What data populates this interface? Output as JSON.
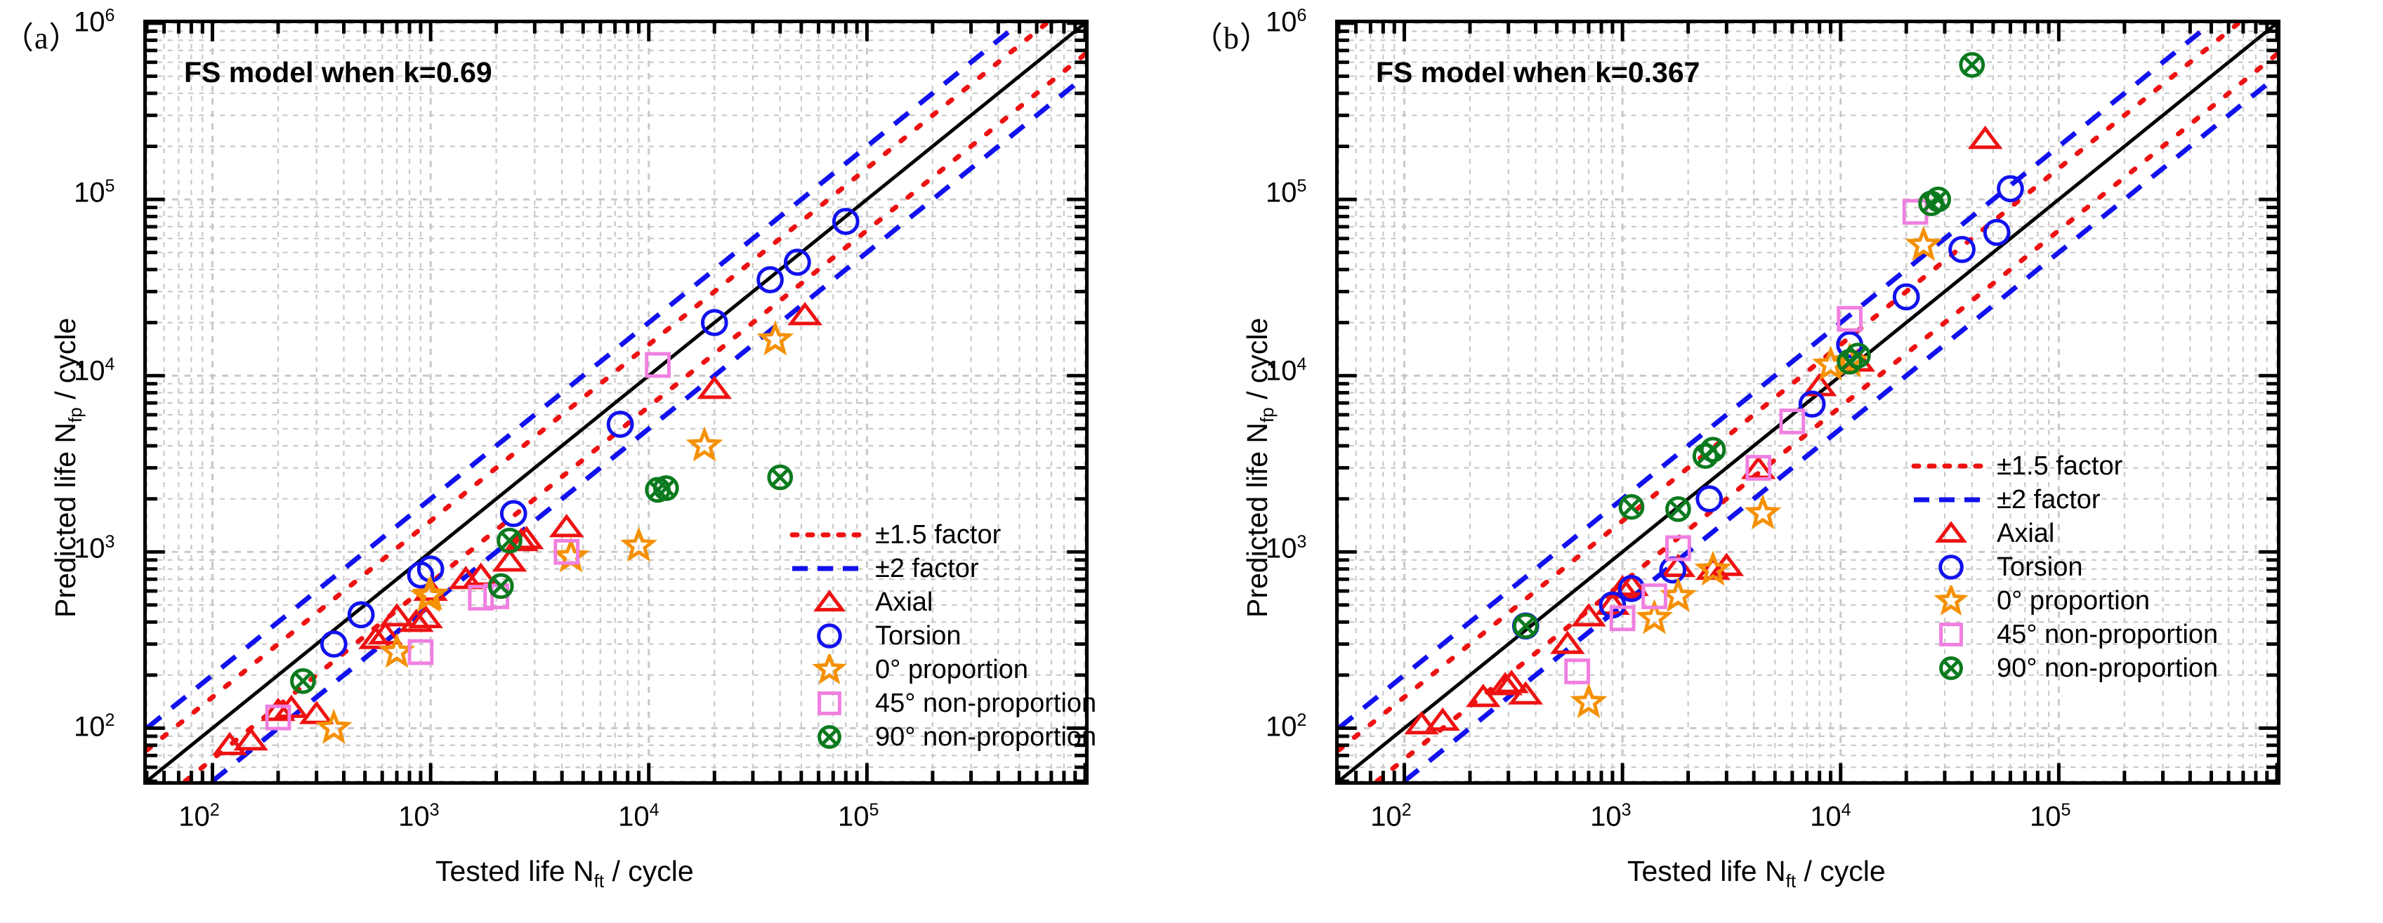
{
  "figure": {
    "panels": [
      {
        "tag": "（a）",
        "title": "FS model when k=0.69",
        "corner_label": "10",
        "corner_exp": "6"
      },
      {
        "tag": "（b）",
        "title": "FS model when k=0.367",
        "corner_label": "10",
        "corner_exp": "6"
      }
    ],
    "axis": {
      "xlabel_pre": "Tested life N",
      "xlabel_sub": "ft",
      "xlabel_post": " / cycle",
      "ylabel_pre": "Predicted life N",
      "ylabel_sub": "fp",
      "ylabel_post": " / cycle",
      "xticks": [
        "10",
        "10",
        "10",
        "10"
      ],
      "xtick_exps": [
        "2",
        "3",
        "4",
        "5"
      ],
      "yticks": [
        "10",
        "10",
        "10",
        "10"
      ],
      "ytick_exps": [
        "2",
        "3",
        "4",
        "5"
      ]
    },
    "legend": {
      "items": [
        {
          "label": "±1.5 factor",
          "marker": "dotted-line-icon",
          "color": "#ee1111"
        },
        {
          "label": "±2 factor",
          "marker": "dashed-line-icon",
          "color": "#1111ee"
        },
        {
          "label": "Axial",
          "marker": "triangle-icon",
          "color": "#ee1111"
        },
        {
          "label": "Torsion",
          "marker": "circle-icon",
          "color": "#1111ee"
        },
        {
          "label": "0° proportion",
          "marker": "star-icon",
          "color": "#f59000"
        },
        {
          "label": "45° non-proportion",
          "marker": "square-icon",
          "color": "#f07fe0"
        },
        {
          "label": "90° non-proportion",
          "marker": "crossed-circle-icon",
          "color": "#0b7a1e"
        }
      ]
    }
  },
  "chart_data": [
    {
      "type": "scatter",
      "title": "FS model when k=0.69",
      "panel": "(a)",
      "xlabel": "Tested life Nft / cycle",
      "ylabel": "Predicted life Nfp / cycle",
      "xscale": "log",
      "yscale": "log",
      "xlim": [
        50,
        1000000
      ],
      "ylim": [
        50,
        1000000
      ],
      "grid": true,
      "legend_position": "lower-right-inside",
      "reference_lines": [
        {
          "name": "1:1 line",
          "style": "solid",
          "color": "#000000",
          "factor": 1
        },
        {
          "name": "+1.5 factor",
          "style": "dotted",
          "color": "#ee1111",
          "factor": 1.5
        },
        {
          "name": "-1.5 factor",
          "style": "dotted",
          "color": "#ee1111",
          "factor": 0.6667
        },
        {
          "name": "+2 factor",
          "style": "dashed",
          "color": "#1111ee",
          "factor": 2
        },
        {
          "name": "-2 factor",
          "style": "dashed",
          "color": "#1111ee",
          "factor": 0.5
        }
      ],
      "series": [
        {
          "name": "Axial",
          "marker": "triangle",
          "color": "#ee1111",
          "points": [
            [
              120,
              80
            ],
            [
              150,
              85
            ],
            [
              200,
              125
            ],
            [
              230,
              130
            ],
            [
              300,
              120
            ],
            [
              560,
              320
            ],
            [
              620,
              340
            ],
            [
              700,
              430
            ],
            [
              860,
              400
            ],
            [
              950,
              420
            ],
            [
              1000,
              600
            ],
            [
              1450,
              700
            ],
            [
              1700,
              730
            ],
            [
              2300,
              880
            ],
            [
              2600,
              1150
            ],
            [
              2750,
              1180
            ],
            [
              4200,
              1380
            ],
            [
              20000,
              8400
            ],
            [
              52000,
              22000
            ]
          ]
        },
        {
          "name": "Torsion",
          "marker": "circle",
          "color": "#1111ee",
          "points": [
            [
              360,
              300
            ],
            [
              480,
              440
            ],
            [
              900,
              740
            ],
            [
              1000,
              800
            ],
            [
              2400,
              1650
            ],
            [
              7400,
              5300
            ],
            [
              20000,
              20000
            ],
            [
              36000,
              35000
            ],
            [
              48000,
              44000
            ],
            [
              80000,
              75000
            ]
          ]
        },
        {
          "name": "0° proportion",
          "marker": "star",
          "color": "#f59000",
          "points": [
            [
              360,
              100
            ],
            [
              700,
              270
            ],
            [
              980,
              560
            ],
            [
              1000,
              570
            ],
            [
              4400,
              940
            ],
            [
              9000,
              1080
            ],
            [
              18000,
              4000
            ],
            [
              38000,
              16000
            ]
          ]
        },
        {
          "name": "45° non-proportion",
          "marker": "square",
          "color": "#f07fe0",
          "points": [
            [
              200,
              115
            ],
            [
              900,
              270
            ],
            [
              1700,
              550
            ],
            [
              2000,
              560
            ],
            [
              4200,
              1000
            ],
            [
              11000,
              11500
            ]
          ]
        },
        {
          "name": "90° non-proportion",
          "marker": "crossed-circle",
          "color": "#0b7a1e",
          "points": [
            [
              260,
              185
            ],
            [
              2100,
              640
            ],
            [
              2300,
              1160
            ],
            [
              11000,
              2250
            ],
            [
              12000,
              2300
            ],
            [
              40000,
              2650
            ]
          ]
        }
      ]
    },
    {
      "type": "scatter",
      "title": "FS model when k=0.367",
      "panel": "(b)",
      "xlabel": "Tested life Nft / cycle",
      "ylabel": "Predicted life Nfp / cycle",
      "xscale": "log",
      "yscale": "log",
      "xlim": [
        50,
        1000000
      ],
      "ylim": [
        50,
        1000000
      ],
      "grid": true,
      "legend_position": "lower-right-inside",
      "reference_lines": [
        {
          "name": "1:1 line",
          "style": "solid",
          "color": "#000000",
          "factor": 1
        },
        {
          "name": "+1.5 factor",
          "style": "dotted",
          "color": "#ee1111",
          "factor": 1.5
        },
        {
          "name": "-1.5 factor",
          "style": "dotted",
          "color": "#ee1111",
          "factor": 0.6667
        },
        {
          "name": "+2 factor",
          "style": "dashed",
          "color": "#1111ee",
          "factor": 2
        },
        {
          "name": "-2 factor",
          "style": "dashed",
          "color": "#1111ee",
          "factor": 0.5
        }
      ],
      "series": [
        {
          "name": "Axial",
          "marker": "triangle",
          "color": "#ee1111",
          "points": [
            [
              120,
              105
            ],
            [
              150,
              110
            ],
            [
              230,
              150
            ],
            [
              290,
              175
            ],
            [
              310,
              180
            ],
            [
              360,
              155
            ],
            [
              560,
              300
            ],
            [
              700,
              430
            ],
            [
              900,
              500
            ],
            [
              1000,
              620
            ],
            [
              1100,
              640
            ],
            [
              1800,
              820
            ],
            [
              2600,
              790
            ],
            [
              3000,
              830
            ],
            [
              4200,
              2950
            ],
            [
              8000,
              8700
            ],
            [
              12000,
              12000
            ],
            [
              46000,
              220000
            ]
          ]
        },
        {
          "name": "Torsion",
          "marker": "circle",
          "color": "#1111ee",
          "points": [
            [
              360,
              380
            ],
            [
              900,
              500
            ],
            [
              1100,
              620
            ],
            [
              1700,
              790
            ],
            [
              2500,
              2000
            ],
            [
              7400,
              6900
            ],
            [
              11000,
              15000
            ],
            [
              20000,
              28000
            ],
            [
              36000,
              52000
            ],
            [
              52000,
              65000
            ],
            [
              60000,
              115000
            ]
          ]
        },
        {
          "name": "0° proportion",
          "marker": "star",
          "color": "#f59000",
          "points": [
            [
              700,
              140
            ],
            [
              1400,
              420
            ],
            [
              1800,
              560
            ],
            [
              2600,
              790
            ],
            [
              4400,
              1650
            ],
            [
              9000,
              11500
            ],
            [
              11000,
              12000
            ],
            [
              24000,
              55000
            ]
          ]
        },
        {
          "name": "45° non-proportion",
          "marker": "square",
          "color": "#f07fe0",
          "points": [
            [
              620,
              210
            ],
            [
              1000,
              420
            ],
            [
              1400,
              560
            ],
            [
              1800,
              1050
            ],
            [
              4200,
              3000
            ],
            [
              6000,
              5500
            ],
            [
              11000,
              21000
            ],
            [
              22000,
              85000
            ]
          ]
        },
        {
          "name": "90° non-proportion",
          "marker": "crossed-circle",
          "color": "#0b7a1e",
          "points": [
            [
              360,
              380
            ],
            [
              1100,
              1800
            ],
            [
              1800,
              1750
            ],
            [
              2400,
              3500
            ],
            [
              2600,
              3800
            ],
            [
              11000,
              12000
            ],
            [
              12000,
              13000
            ],
            [
              26000,
              95000
            ],
            [
              28000,
              100000
            ],
            [
              40000,
              580000
            ]
          ]
        }
      ]
    }
  ]
}
